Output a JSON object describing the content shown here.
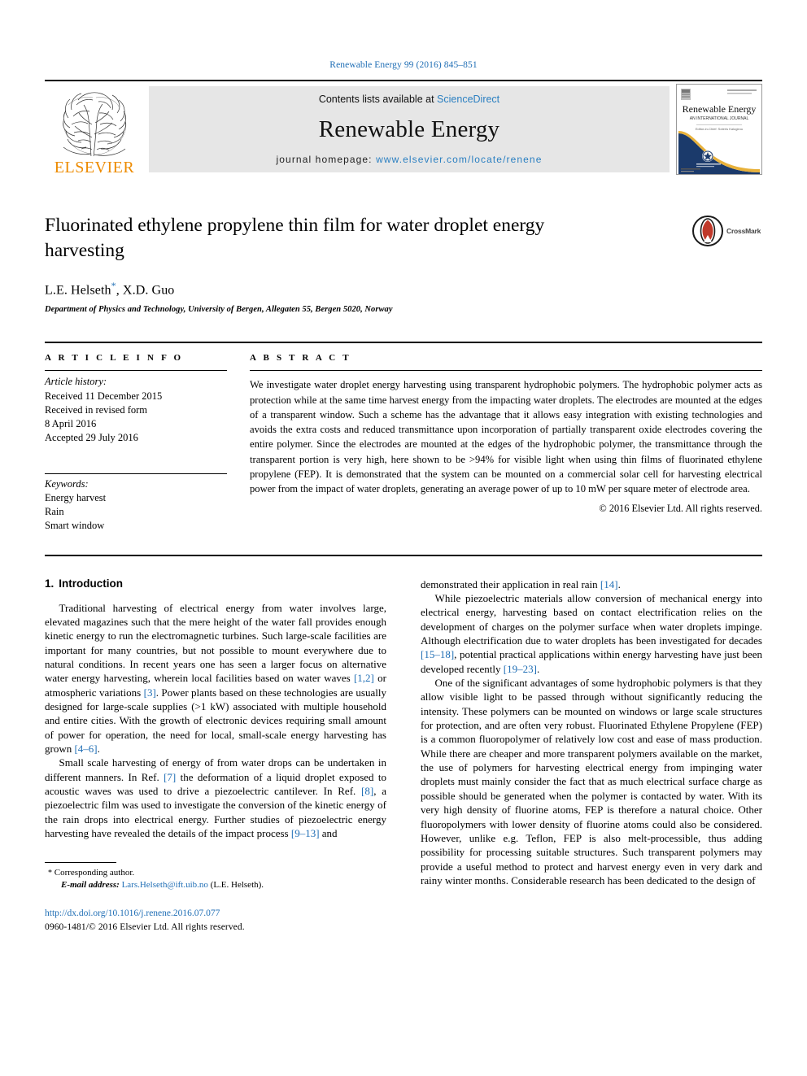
{
  "runhead": "Renewable Energy 99 (2016) 845–851",
  "masthead": {
    "publisher_name": "ELSEVIER",
    "contents_prefix": "Contents lists available at",
    "contents_link": "ScienceDirect",
    "journal_name": "Renewable Energy",
    "homepage_prefix": "journal homepage:",
    "homepage_url": "www.elsevier.com/locate/renene",
    "cover": {
      "title": "Renewable Energy",
      "subtitle": "AN INTERNATIONAL JOURNAL"
    }
  },
  "article": {
    "title": "Fluorinated ethylene propylene thin film for water droplet energy harvesting",
    "authors": "L.E. Helseth",
    "authors_tail": ", X.D. Guo",
    "affiliation": "Department of Physics and Technology, University of Bergen, Allegaten 55, Bergen 5020, Norway",
    "crossmark_label": "CrossMark"
  },
  "info": {
    "heading": "A R T I C L E  I N F O",
    "history_label": "Article history:",
    "history": [
      "Received 11 December 2015",
      "Received in revised form",
      "8 April 2016",
      "Accepted 29 July 2016"
    ],
    "keywords_label": "Keywords:",
    "keywords": [
      "Energy harvest",
      "Rain",
      "Smart window"
    ]
  },
  "abstract": {
    "heading": "A B S T R A C T",
    "text": "We investigate water droplet energy harvesting using transparent hydrophobic polymers. The hydrophobic polymer acts as protection while at the same time harvest energy from the impacting water droplets. The electrodes are mounted at the edges of a transparent window. Such a scheme has the advantage that it allows easy integration with existing technologies and avoids the extra costs and reduced transmittance upon incorporation of partially transparent oxide electrodes covering the entire polymer. Since the electrodes are mounted at the edges of the hydrophobic polymer, the transmittance through the transparent portion is very high, here shown to be >94% for visible light when using thin films of fluorinated ethylene propylene (FEP). It is demonstrated that the system can be mounted on a commercial solar cell for harvesting electrical power from the impact of water droplets, generating an average power of up to 10 mW per square meter of electrode area.",
    "copyright": "© 2016 Elsevier Ltd. All rights reserved."
  },
  "body": {
    "section_number": "1.",
    "section_title": "Introduction",
    "left_paragraphs": [
      "Traditional harvesting of electrical energy from water involves large, elevated magazines such that the mere height of the water fall provides enough kinetic energy to run the electromagnetic turbines. Such large-scale facilities are important for many countries, but not possible to mount everywhere due to natural conditions. In recent years one has seen a larger focus on alternative water energy harvesting, wherein local facilities based on water waves [1,2] or atmospheric variations [3]. Power plants based on these technologies are usually designed for large-scale supplies (>1 kW) associated with multiple household and entire cities. With the growth of electronic devices requiring small amount of power for operation, the need for local, small-scale energy harvesting has grown [4–6].",
      "Small scale harvesting of energy of from water drops can be undertaken in different manners. In Ref. [7] the deformation of a liquid droplet exposed to acoustic waves was used to drive a piezoelectric cantilever. In Ref. [8], a piezoelectric film was used to investigate the conversion of the kinetic energy of the rain drops into electrical energy. Further studies of piezoelectric energy harvesting have revealed the details of the impact process [9–13] and"
    ],
    "right_paragraphs": [
      "demonstrated their application in real rain [14].",
      "While piezoelectric materials allow conversion of mechanical energy into electrical energy, harvesting based on contact electrification relies on the development of charges on the polymer surface when water droplets impinge. Although electrification due to water droplets has been investigated for decades [15–18], potential practical applications within energy harvesting have just been developed recently [19–23].",
      "One of the significant advantages of some hydrophobic polymers is that they allow visible light to be passed through without significantly reducing the intensity. These polymers can be mounted on windows or large scale structures for protection, and are often very robust. Fluorinated Ethylene Propylene (FEP) is a common fluoropolymer of relatively low cost and ease of mass production. While there are cheaper and more transparent polymers available on the market, the use of polymers for harvesting electrical energy from impinging water droplets must mainly consider the fact that as much electrical surface charge as possible should be generated when the polymer is contacted by water. With its very high density of fluorine atoms, FEP is therefore a natural choice. Other fluoropolymers with lower density of fluorine atoms could also be considered. However, unlike e.g. Teflon, FEP is also melt-processible, thus adding possibility for processing suitable structures. Such transparent polymers may provide a useful method to protect and harvest energy even in very dark and rainy winter months. Considerable research has been dedicated to the design of"
    ]
  },
  "footer": {
    "corresponding_star": "*",
    "corresponding_label": "Corresponding author.",
    "email_label": "E-mail address:",
    "email": "Lars.Helseth@ift.uib.no",
    "email_owner": "(L.E. Helseth).",
    "doi": "http://dx.doi.org/10.1016/j.renene.2016.07.077",
    "issn_line": "0960-1481/© 2016 Elsevier Ltd. All rights reserved."
  },
  "colors": {
    "link": "#1f6eb5",
    "elsevier_orange": "#ED8B00",
    "band_gray": "#e6e6e6"
  }
}
